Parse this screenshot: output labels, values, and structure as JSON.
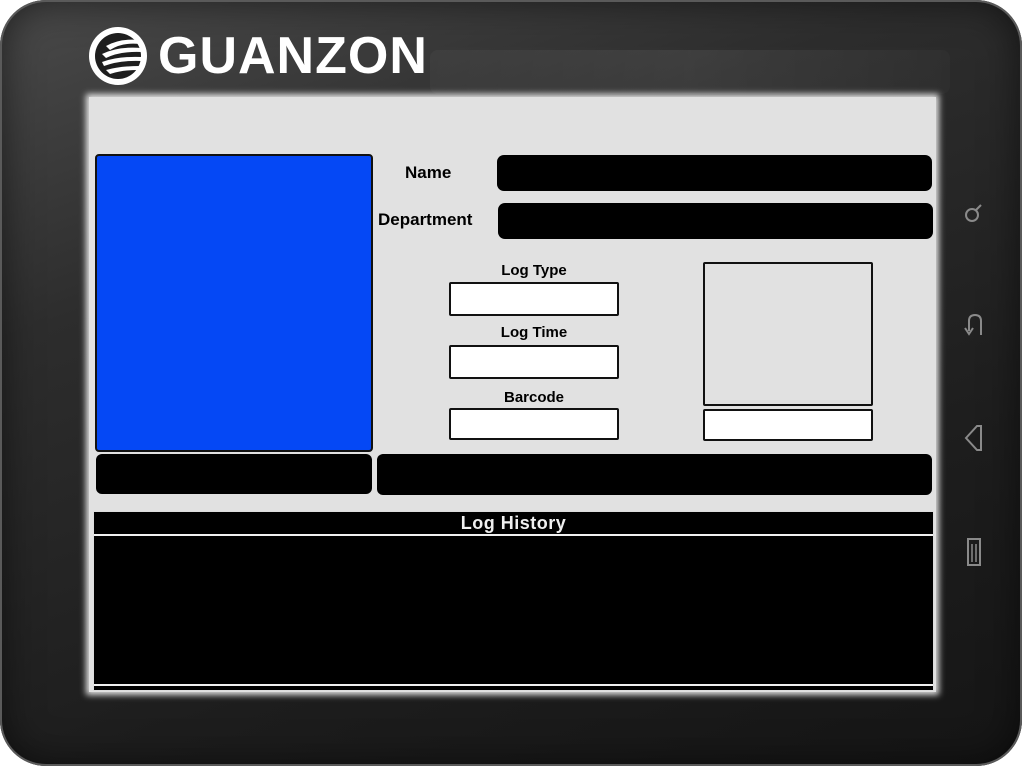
{
  "brand": {
    "name": "GUANZON",
    "logo_icon": "guanzon-logo-icon"
  },
  "form": {
    "name_label": "Name",
    "name_value": "",
    "department_label": "Department",
    "department_value": "",
    "log_type_label": "Log Type",
    "log_type_value": "",
    "log_time_label": "Log Time",
    "log_time_value": "",
    "barcode_label": "Barcode",
    "barcode_value": ""
  },
  "history": {
    "title": "Log History"
  },
  "device_buttons": [
    "search-icon",
    "back-icon",
    "home-icon",
    "menu-icon"
  ],
  "colors": {
    "photo_placeholder": "#0548f5",
    "screen_background": "#e1e1e1",
    "field_dark": "#000000"
  }
}
